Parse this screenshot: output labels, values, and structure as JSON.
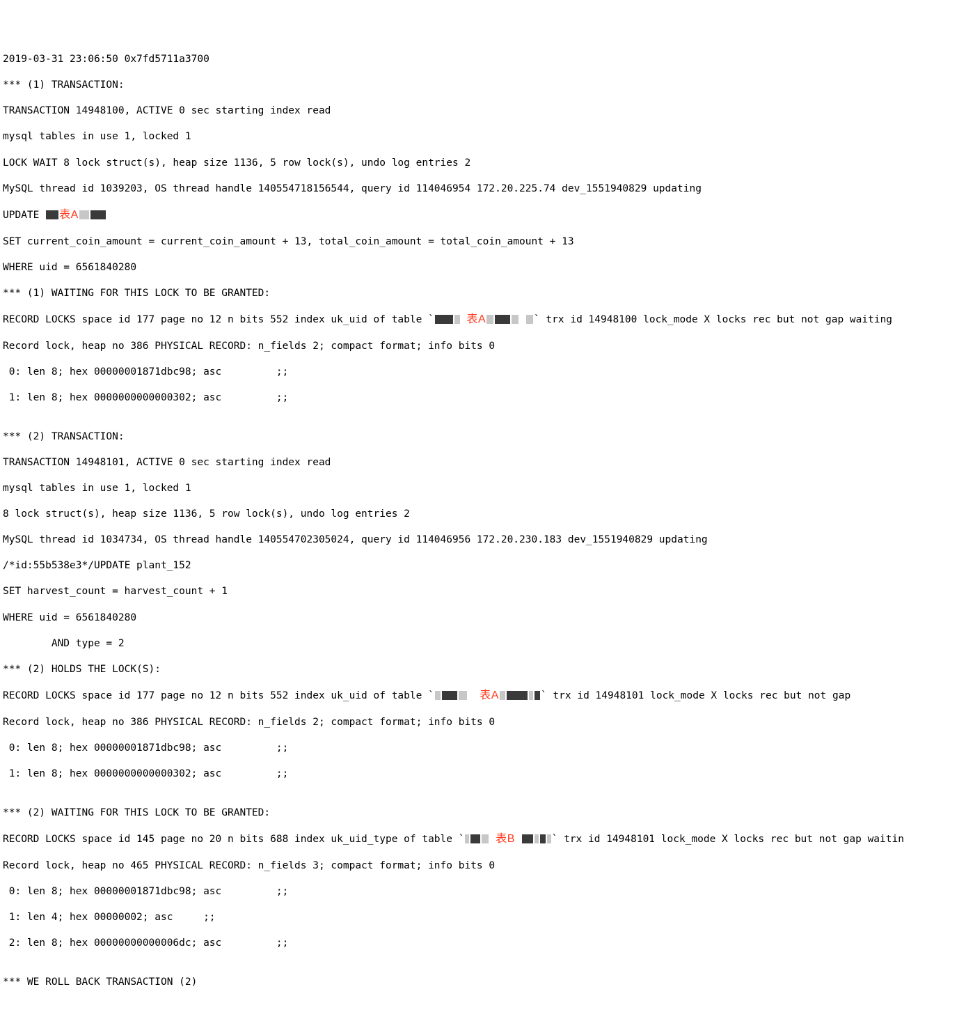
{
  "annotations": {
    "tableA": "表A",
    "tableB": "表B"
  },
  "lines": {
    "l0": "2019-03-31 23:06:50 0x7fd5711a3700",
    "l1": "*** (1) TRANSACTION:",
    "l2": "TRANSACTION 14948100, ACTIVE 0 sec starting index read",
    "l3": "mysql tables in use 1, locked 1",
    "l4": "LOCK WAIT 8 lock struct(s), heap size 1136, 5 row lock(s), undo log entries 2",
    "l5": "MySQL thread id 1039203, OS thread handle 140554718156544, query id 114046954 172.20.225.74 dev_1551940829 updating",
    "l6a": "UPDATE ",
    "l6b": "",
    "l7": "SET current_coin_amount = current_coin_amount + 13, total_coin_amount = total_coin_amount + 13",
    "l8": "WHERE uid = 6561840280",
    "l9": "*** (1) WAITING FOR THIS LOCK TO BE GRANTED:",
    "l10a": "RECORD LOCKS space id 177 page no 12 n bits 552 index uk_uid of table `",
    "l10b": "` trx id 14948100 lock_mode X locks rec but not gap waiting",
    "l11": "Record lock, heap no 386 PHYSICAL RECORD: n_fields 2; compact format; info bits 0",
    "l12": " 0: len 8; hex 00000001871dbc98; asc         ;;",
    "l13": " 1: len 8; hex 0000000000000302; asc         ;;",
    "l14": "",
    "l15": "*** (2) TRANSACTION:",
    "l16": "TRANSACTION 14948101, ACTIVE 0 sec starting index read",
    "l17": "mysql tables in use 1, locked 1",
    "l18": "8 lock struct(s), heap size 1136, 5 row lock(s), undo log entries 2",
    "l19": "MySQL thread id 1034734, OS thread handle 140554702305024, query id 114046956 172.20.230.183 dev_1551940829 updating",
    "l20": "/*id:55b538e3*/UPDATE plant_152",
    "l21": "SET harvest_count = harvest_count + 1",
    "l22": "WHERE uid = 6561840280",
    "l23": "        AND type = 2",
    "l24": "*** (2) HOLDS THE LOCK(S):",
    "l25a": "RECORD LOCKS space id 177 page no 12 n bits 552 index uk_uid of table `",
    "l25b": "` trx id 14948101 lock_mode X locks rec but not gap",
    "l26": "Record lock, heap no 386 PHYSICAL RECORD: n_fields 2; compact format; info bits 0",
    "l27": " 0: len 8; hex 00000001871dbc98; asc         ;;",
    "l28": " 1: len 8; hex 0000000000000302; asc         ;;",
    "l29": "",
    "l30": "*** (2) WAITING FOR THIS LOCK TO BE GRANTED:",
    "l31a": "RECORD LOCKS space id 145 page no 20 n bits 688 index uk_uid_type of table `",
    "l31b": "` trx id 14948101 lock_mode X locks rec but not gap waitin",
    "l32": "Record lock, heap no 465 PHYSICAL RECORD: n_fields 3; compact format; info bits 0",
    "l33": " 0: len 8; hex 00000001871dbc98; asc         ;;",
    "l34": " 1: len 4; hex 00000002; asc     ;;",
    "l35": " 2: len 8; hex 00000000000006dc; asc         ;;",
    "l36": "",
    "l37": "*** WE ROLL BACK TRANSACTION (2)"
  }
}
